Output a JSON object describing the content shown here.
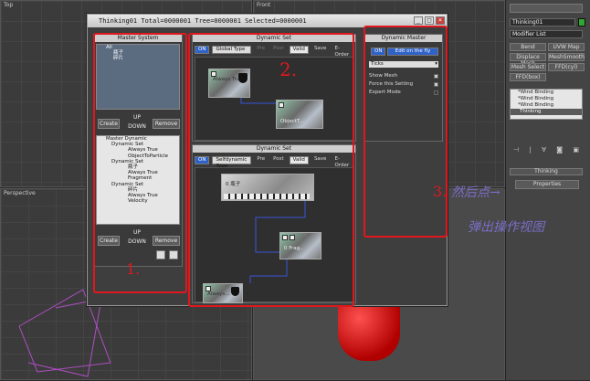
{
  "viewports": {
    "top": "Top",
    "front": "Front",
    "perspective": "Perspective"
  },
  "command_panel": {
    "object_name": "Thinking01",
    "modifier_list": "Modifier List",
    "buttons": [
      "Bend",
      "UVW Map",
      "Displace Mesh",
      "MeshSmooth",
      "Mesh Select",
      "FFD(cyl)",
      "FFD(box)"
    ],
    "stack": [
      "*Wind Binding",
      "*Wind Binding",
      "*Wind Binding",
      "Thinking"
    ],
    "rollout_title": "Thinking",
    "properties_label": "Properties"
  },
  "window": {
    "title": "Thinking01   Total=0000001   Tree=0000001   Selected=0000001"
  },
  "master_system": {
    "title": "Master System",
    "tree_top": [
      "All",
      "瓶子",
      "碎片"
    ],
    "create": "Create",
    "up": "UP",
    "down": "DOWN",
    "remove": "Remove",
    "tree_bottom": [
      "Master Dynamic",
      "Dynamic Set",
      "Always True",
      "ObjectToParticle",
      "Dynamic Set",
      "瓶子",
      "Always True",
      "Fragment",
      "Dynamic Set",
      "碎片",
      "Always True",
      "Velocity"
    ],
    "create2": "Create",
    "up2": "UP",
    "down2": "DOWN",
    "remove2": "Remove"
  },
  "dynamic_set_1": {
    "title": "Dynamic Set",
    "on": "ON",
    "type": "Global Type",
    "pre": "Pre",
    "post": "Post",
    "valid": "Valid",
    "save": "Save",
    "eorder": "E-Order",
    "node_a": "Always True",
    "node_b": "ObjectT..."
  },
  "dynamic_set_2": {
    "title": "Dynamic Set",
    "on": "ON",
    "type": "Selfdynamic Type",
    "pre": "Pre",
    "post": "Post",
    "valid": "Valid",
    "save": "Save",
    "eorder": "E-Order",
    "node_a": "0 瓶子",
    "node_b": "0 Frag..",
    "node_c": "Always..."
  },
  "dynamic_master": {
    "title": "Dynamic Master",
    "on": "ON",
    "edit": "Edit on the fly",
    "ticks": "Ticks",
    "show_mesh": "Show Mesh",
    "force": "Force this Setting",
    "expert": "Expert Mode"
  },
  "annotations": {
    "one": "1.",
    "two": "2.",
    "three": "3.",
    "note_line1": "然后点→",
    "note_line2": "弹出操作视图"
  },
  "colors": {
    "red": "#e0181e",
    "accent_blue": "#2f63c8",
    "annotation": "#7a6ec8"
  }
}
